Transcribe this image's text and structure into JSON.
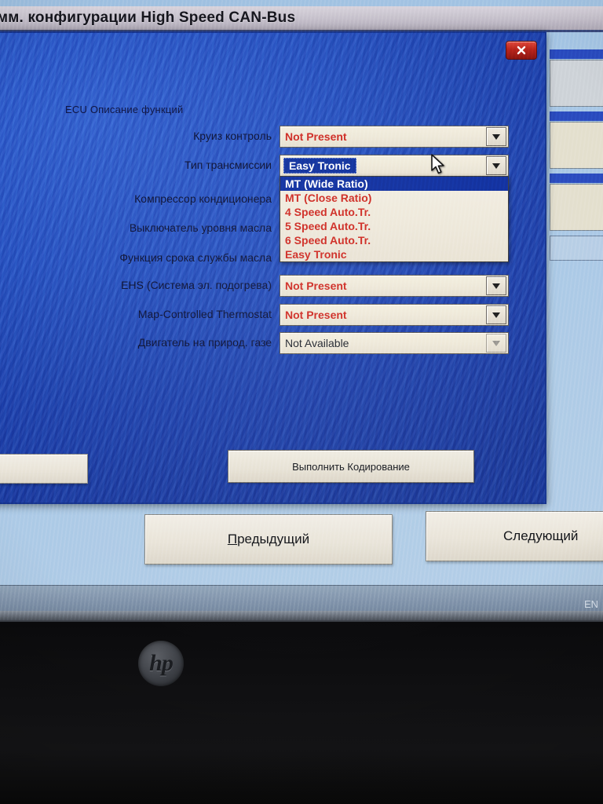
{
  "window": {
    "outer_title": "мм. конфигурации High Speed CAN-Bus"
  },
  "dialog": {
    "section_label": "ECU Описание функций",
    "close_icon": "close-x-icon",
    "rows": [
      {
        "label": "Круиз контроль",
        "value": "Not Present",
        "style": "red",
        "arrow": "chevron-down-icon",
        "state": "normal"
      },
      {
        "label": "Тип трансмиссии",
        "value": "Easy Tronic",
        "style": "sel",
        "arrow": "chevron-down-icon",
        "state": "open"
      },
      {
        "label": "Компрессор кондиционера",
        "value": "",
        "style": "red",
        "arrow": "chevron-down-icon",
        "state": "covered"
      },
      {
        "label": "Выключатель уровня масла",
        "value": "",
        "style": "red",
        "arrow": "chevron-down-icon",
        "state": "covered"
      },
      {
        "label": "Функция срока службы масла",
        "value": "",
        "style": "red",
        "arrow": "chevron-down-icon",
        "state": "covered"
      },
      {
        "label": "EHS (Система эл. подогрева)",
        "value": "Not Present",
        "style": "red",
        "arrow": "chevron-down-icon",
        "state": "normal"
      },
      {
        "label": "Map-Controlled Thermostat",
        "value": "Not Present",
        "style": "red",
        "arrow": "chevron-down-icon",
        "state": "normal"
      },
      {
        "label": "Двигатель на природ. газе",
        "value": "Not Available",
        "style": "dark",
        "arrow": "chevron-down-icon",
        "state": "disabled"
      }
    ],
    "dropdown": {
      "owner": "Тип трансмиссии",
      "selected_index": 0,
      "options": [
        "MT (Wide Ratio)",
        "MT (Close Ratio)",
        "4 Speed Auto.Tr.",
        "5 Speed Auto.Tr.",
        "6 Speed Auto.Tr.",
        "Easy Tronic"
      ]
    },
    "execute_button": "Выполнить Кодирование"
  },
  "wizard": {
    "left_partial_button": "",
    "previous_button": {
      "accel": "П",
      "rest": "редыдущий"
    },
    "next_button": "Следующий"
  },
  "taskbar": {
    "language_indicator": "EN"
  },
  "hardware": {
    "brand_logo": "hp"
  },
  "colors": {
    "dialog_blue": "#2450c4",
    "value_red": "#cf2a22",
    "highlight_blue": "#0f2fa0",
    "desktop_blue": "#a9c8e6",
    "close_red": "#b8241b"
  }
}
